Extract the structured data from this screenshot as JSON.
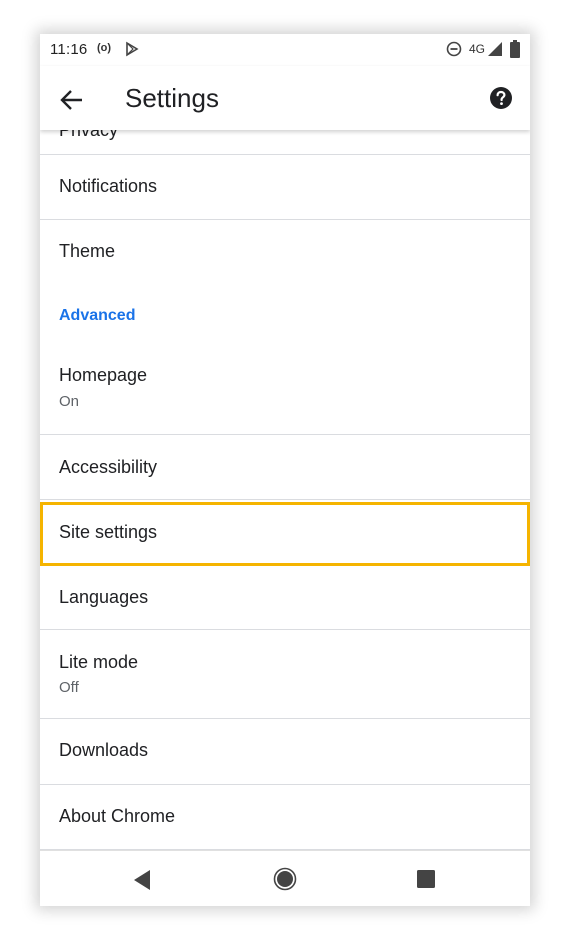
{
  "status_bar": {
    "time": "11:16",
    "radio_icon": "(o)",
    "network": "4G",
    "icons": [
      "radio-icon",
      "play-icon",
      "dnd-icon",
      "signal-icon",
      "battery-icon"
    ]
  },
  "app_bar": {
    "title": "Settings",
    "back_icon": "arrow-back-icon",
    "help_icon": "help-icon"
  },
  "list": {
    "items": [
      {
        "title": "Notifications"
      },
      {
        "title": "Theme"
      },
      {
        "section": "Advanced"
      },
      {
        "title": "Homepage",
        "subtitle": "On"
      },
      {
        "title": "Accessibility"
      },
      {
        "title": "Site settings",
        "highlighted": true
      },
      {
        "title": "Languages"
      },
      {
        "title": "Lite mode",
        "subtitle": "Off"
      },
      {
        "title": "Downloads"
      },
      {
        "title": "About Chrome"
      }
    ]
  },
  "nav_bar": {
    "icons": [
      "nav-back-icon",
      "nav-home-icon",
      "nav-recents-icon"
    ]
  },
  "colors": {
    "accent": "#1a73e8",
    "highlight": "#f5b400",
    "text_primary": "#202124",
    "text_secondary": "#5f6368",
    "divider": "#dadce0"
  }
}
